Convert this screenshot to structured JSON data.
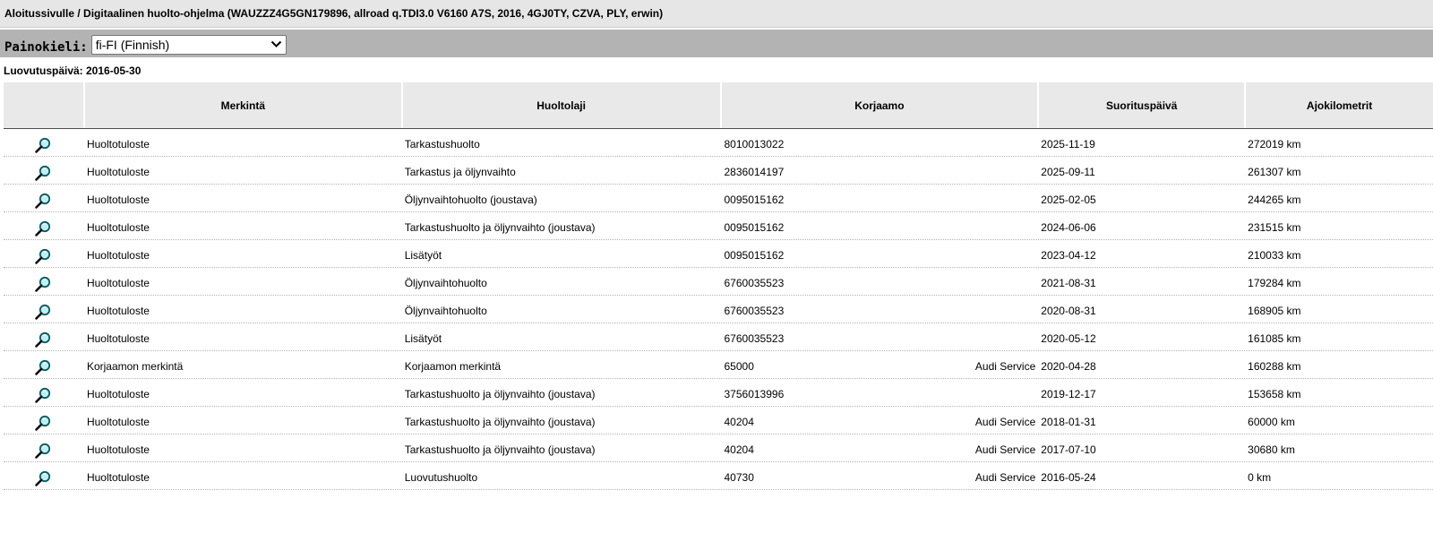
{
  "breadcrumb": {
    "home": "Aloitussivulle",
    "separator": " / ",
    "title": "Digitaalinen huolto-ohjelma (WAUZZZ4G5GN179896, allroad q.TDI3.0 V6160 A7S, 2016, 4GJ0TY, CZVA, PLY, erwin)"
  },
  "language": {
    "label": "Painokieli:",
    "selected": "fi-FI (Finnish)"
  },
  "delivery_date": "Luovutuspäivä: 2016-05-30",
  "table": {
    "headers": [
      "",
      "Merkintä",
      "Huoltolaji",
      "Korjaamo",
      "Suorituspäivä",
      "Ajokilometrit"
    ],
    "rows": [
      {
        "entry": "Huoltotuloste",
        "service": "Tarkastushuolto",
        "workshop": "8010013022",
        "dealer": "",
        "date": "2025-11-19",
        "km": "272019 km"
      },
      {
        "entry": "Huoltotuloste",
        "service": "Tarkastus ja öljynvaihto",
        "workshop": "2836014197",
        "dealer": "",
        "date": "2025-09-11",
        "km": "261307 km"
      },
      {
        "entry": "Huoltotuloste",
        "service": "Öljynvaihtohuolto (joustava)",
        "workshop": "0095015162",
        "dealer": "",
        "date": "2025-02-05",
        "km": "244265 km"
      },
      {
        "entry": "Huoltotuloste",
        "service": "Tarkastushuolto ja öljynvaihto (joustava)",
        "workshop": "0095015162",
        "dealer": "",
        "date": "2024-06-06",
        "km": "231515 km"
      },
      {
        "entry": "Huoltotuloste",
        "service": "Lisätyöt",
        "workshop": "0095015162",
        "dealer": "",
        "date": "2023-04-12",
        "km": "210033 km"
      },
      {
        "entry": "Huoltotuloste",
        "service": "Öljynvaihtohuolto",
        "workshop": "6760035523",
        "dealer": "",
        "date": "2021-08-31",
        "km": "179284 km"
      },
      {
        "entry": "Huoltotuloste",
        "service": "Öljynvaihtohuolto",
        "workshop": "6760035523",
        "dealer": "",
        "date": "2020-08-31",
        "km": "168905 km"
      },
      {
        "entry": "Huoltotuloste",
        "service": "Lisätyöt",
        "workshop": "6760035523",
        "dealer": "",
        "date": "2020-05-12",
        "km": "161085 km"
      },
      {
        "entry": "Korjaamon merkintä",
        "service": "Korjaamon merkintä",
        "workshop": "65000",
        "dealer": "Audi Service",
        "date": "2020-04-28",
        "km": "160288 km"
      },
      {
        "entry": "Huoltotuloste",
        "service": "Tarkastushuolto ja öljynvaihto (joustava)",
        "workshop": "3756013996",
        "dealer": "",
        "date": "2019-12-17",
        "km": "153658 km"
      },
      {
        "entry": "Huoltotuloste",
        "service": "Tarkastushuolto ja öljynvaihto (joustava)",
        "workshop": "40204",
        "dealer": "Audi Service",
        "date": "2018-01-31",
        "km": "60000 km"
      },
      {
        "entry": "Huoltotuloste",
        "service": "Tarkastushuolto ja öljynvaihto (joustava)",
        "workshop": "40204",
        "dealer": "Audi Service",
        "date": "2017-07-10",
        "km": "30680 km"
      },
      {
        "entry": "Huoltotuloste",
        "service": "Luovutushuolto",
        "workshop": "40730",
        "dealer": "Audi Service",
        "date": "2016-05-24",
        "km": "0 km"
      }
    ],
    "row_icon": "magnifier-icon"
  }
}
